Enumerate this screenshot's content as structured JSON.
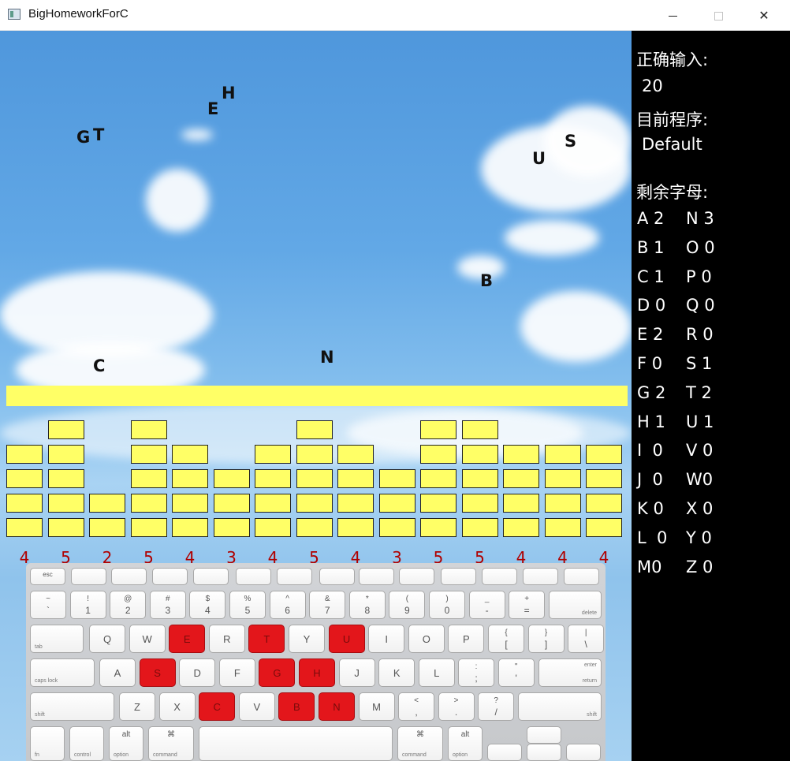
{
  "window": {
    "title": "BigHomeworkForC",
    "min_symbol": "",
    "close_symbol": "✕"
  },
  "falling_letters": [
    "G",
    "T",
    "E",
    "H",
    "U",
    "S",
    "B",
    "C",
    "N"
  ],
  "columns": [
    {
      "height": 4,
      "count": "4"
    },
    {
      "height": 5,
      "count": "5"
    },
    {
      "height": 2,
      "count": "2"
    },
    {
      "height": 5,
      "count": "5"
    },
    {
      "height": 4,
      "count": "4"
    },
    {
      "height": 3,
      "count": "3"
    },
    {
      "height": 4,
      "count": "4"
    },
    {
      "height": 5,
      "count": "5"
    },
    {
      "height": 4,
      "count": "4"
    },
    {
      "height": 3,
      "count": "3"
    },
    {
      "height": 5,
      "count": "5"
    },
    {
      "height": 5,
      "count": "5"
    },
    {
      "height": 4,
      "count": "4"
    },
    {
      "height": 4,
      "count": "4"
    },
    {
      "height": 4,
      "count": "4"
    }
  ],
  "colors": {
    "deadline": "#ffff66",
    "block": "#ffff66",
    "count_label": "#b00000",
    "highlighted_key": "#e3161b",
    "panel_bg": "#000000"
  },
  "panel": {
    "correct_label": "正确输入:",
    "correct_value": "20",
    "program_label": "目前程序:",
    "program_value": "Default",
    "remaining_label": "剩余字母:",
    "letters": [
      {
        "left": "A 2",
        "right": "N 3"
      },
      {
        "left": "B 1",
        "right": "O 0"
      },
      {
        "left": "C 1",
        "right": "P 0"
      },
      {
        "left": "D 0",
        "right": "Q 0"
      },
      {
        "left": "E 2",
        "right": "R 0"
      },
      {
        "left": "F 0",
        "right": "S 1"
      },
      {
        "left": "G 2",
        "right": "T 2"
      },
      {
        "left": "H 1",
        "right": "U 1"
      },
      {
        "left": "I  0",
        "right": "V 0"
      },
      {
        "left": "J  0",
        "right": "W0"
      },
      {
        "left": "K 0",
        "right": "X 0"
      },
      {
        "left": "L  0",
        "right": "Y 0"
      },
      {
        "left": "M0",
        "right": "Z 0"
      }
    ]
  },
  "keyboard": {
    "highlighted": [
      "E",
      "T",
      "U",
      "S",
      "G",
      "H",
      "C",
      "B",
      "N"
    ],
    "fn_row": [
      "esc",
      "",
      "",
      "",
      "",
      "",
      "",
      "",
      "",
      "",
      "",
      "",
      "",
      ""
    ],
    "number_row": [
      {
        "top": "~",
        "bot": "`"
      },
      {
        "top": "!",
        "bot": "1"
      },
      {
        "top": "@",
        "bot": "2"
      },
      {
        "top": "#",
        "bot": "3"
      },
      {
        "top": "$",
        "bot": "4"
      },
      {
        "top": "%",
        "bot": "5"
      },
      {
        "top": "^",
        "bot": "6"
      },
      {
        "top": "&",
        "bot": "7"
      },
      {
        "top": "*",
        "bot": "8"
      },
      {
        "top": "(",
        "bot": "9"
      },
      {
        "top": ")",
        "bot": "0"
      },
      {
        "top": "_",
        "bot": "-"
      },
      {
        "top": "+",
        "bot": "="
      }
    ],
    "delete_label": "delete",
    "tab_label": "tab",
    "row_q": [
      "Q",
      "W",
      "E",
      "R",
      "T",
      "Y",
      "U",
      "I",
      "O",
      "P"
    ],
    "row_q_symbols": [
      {
        "top": "{",
        "bot": "["
      },
      {
        "top": "}",
        "bot": "]"
      },
      {
        "top": "|",
        "bot": "\\"
      }
    ],
    "caps_label": "caps lock",
    "row_a": [
      "A",
      "S",
      "D",
      "F",
      "G",
      "H",
      "J",
      "K",
      "L"
    ],
    "row_a_symbols": [
      {
        "top": ":",
        "bot": ";"
      },
      {
        "top": "\"",
        "bot": "'"
      }
    ],
    "enter_label": "enter",
    "return_label": "return",
    "shift_label": "shift",
    "row_z": [
      "Z",
      "X",
      "C",
      "V",
      "B",
      "N",
      "M"
    ],
    "row_z_symbols": [
      {
        "top": "<",
        "bot": ","
      },
      {
        "top": ">",
        "bot": "."
      },
      {
        "top": "?",
        "bot": "/"
      }
    ],
    "bottom_row": {
      "fn": "fn",
      "control": "control",
      "option": "option",
      "alt": "alt",
      "command": "command",
      "cmd_symbol": "⌘"
    }
  }
}
